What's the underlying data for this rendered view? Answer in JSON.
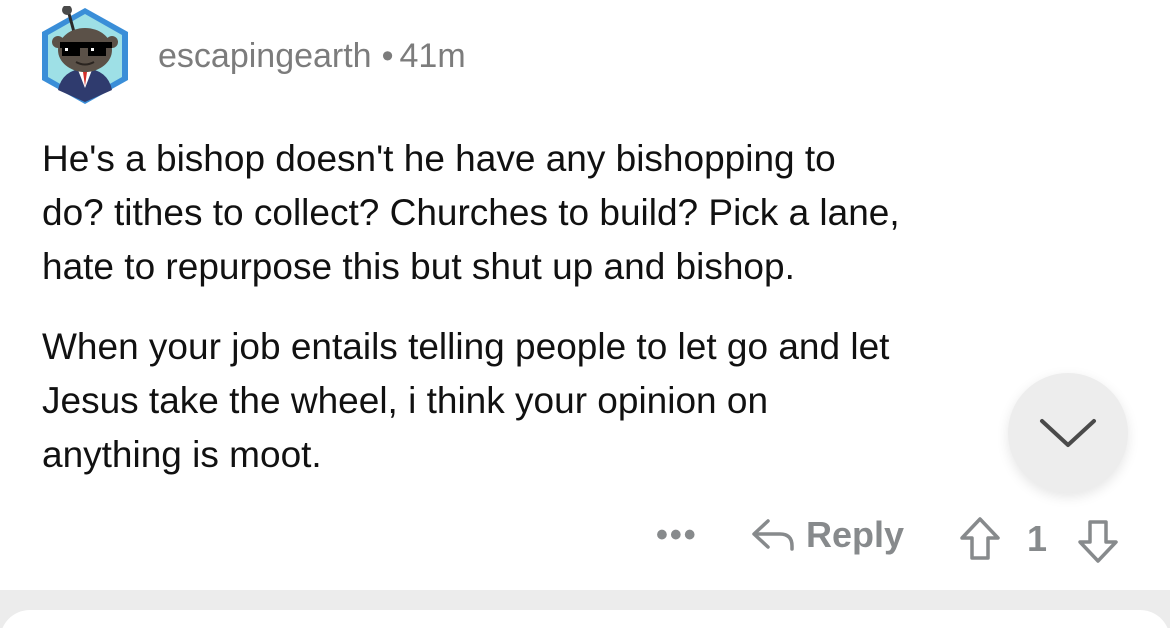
{
  "comment": {
    "username": "escapingearth",
    "separator": "•",
    "age": "41m",
    "avatar_icon": "snoo-sunglasses-avatar-icon",
    "paragraphs": [
      "He's a bishop doesn't he have any bishopping to\ndo? tithes to collect? Churches to build? Pick a lane,\nhate to repurpose this but shut up and bishop.",
      "When your job entails telling people to let go and let\nJesus take the wheel, i think your opinion on\nanything is moot."
    ]
  },
  "actions": {
    "more_label": "•••",
    "reply_icon": "reply-arrow-icon",
    "reply_label": "Reply",
    "upvote_icon": "upvote-arrow-icon",
    "score": "1",
    "downvote_icon": "downvote-arrow-icon"
  },
  "collapse_button": {
    "icon": "chevron-down-icon"
  },
  "colors": {
    "text": "#111111",
    "meta": "#7c7c7c",
    "action_gray": "#878a8c",
    "separator": "#ececec"
  }
}
